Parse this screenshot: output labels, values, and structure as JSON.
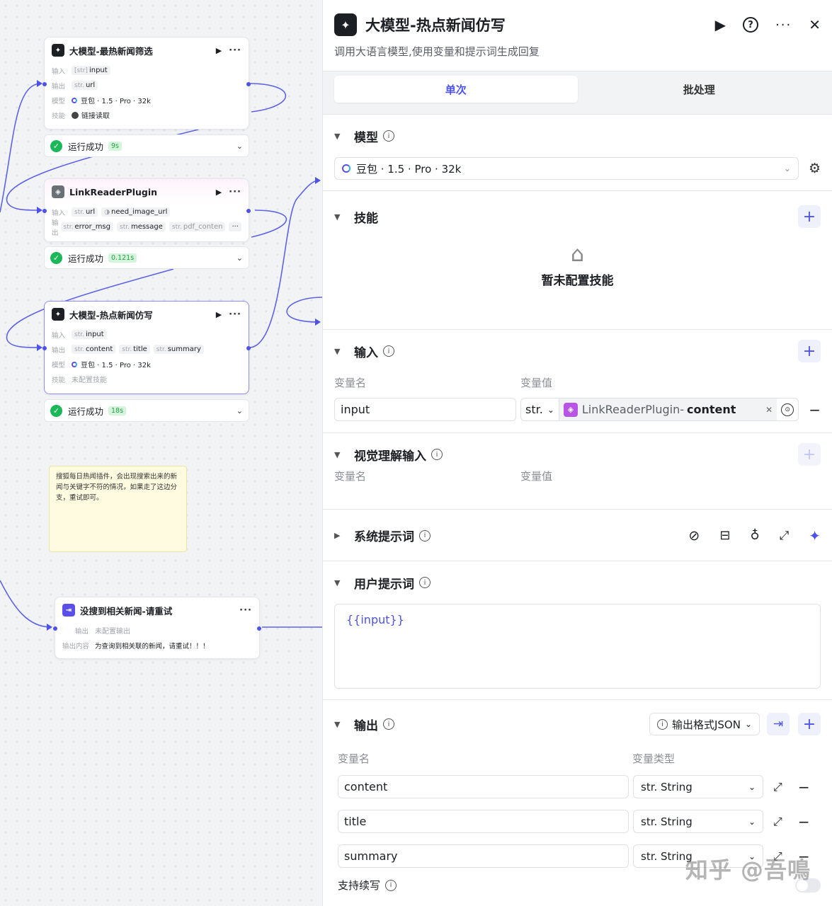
{
  "nodes": {
    "n1": {
      "title": "大模型-最热新闻筛选",
      "in_label": "输入",
      "in_type": "[str]",
      "in_val": "input",
      "out_label": "输出",
      "out_type": "str.",
      "out_val": "url",
      "model_label": "模型",
      "model": "豆包 · 1.5 · Pro · 32k",
      "skill_label": "技能",
      "skill": "链接读取"
    },
    "n2": {
      "title": "LinkReaderPlugin",
      "in_label": "输入",
      "in_type1": "str.",
      "in_val1": "url",
      "in_val2": "need_image_url",
      "out_label": "输出",
      "out_type": "str.",
      "out_val1": "error_msg",
      "out_val2": "message",
      "out_val3": "pdf_conten",
      "more": "···"
    },
    "n3": {
      "title": "大模型-热点新闻仿写",
      "in_label": "输入",
      "in_type": "str.",
      "in_val": "input",
      "out_label": "输出",
      "out_type": "str.",
      "out_val1": "content",
      "out_val2": "title",
      "out_val3": "summary",
      "model_label": "模型",
      "model": "豆包 · 1.5 · Pro · 32k",
      "skill_label": "技能",
      "skill": "未配置技能"
    },
    "n4": {
      "title": "没搜到相关新闻-请重试",
      "out_label": "输出",
      "out_val": "未配置输出",
      "content_label": "输出内容",
      "content": "为查询到相关联的新闻，请重试！！！"
    }
  },
  "statuses": [
    {
      "text": "运行成功",
      "time": "9s"
    },
    {
      "text": "运行成功",
      "time": "0.121s"
    },
    {
      "text": "运行成功",
      "time": "18s"
    }
  ],
  "note": "搜狐每日热闻插件，会出现搜索出来的新闻与关键字不符的情况，如果走了这边分支，重试即可。",
  "panel": {
    "title": "大模型-热点新闻仿写",
    "desc": "调用大语言模型,使用变量和提示词生成回复",
    "tabs": [
      "单次",
      "批处理"
    ],
    "model_section": "模型",
    "model_value": "豆包 · 1.5 · Pro · 32k",
    "skills_section": "技能",
    "skills_empty": "暂未配置技能",
    "input_section": "输入",
    "col_name": "变量名",
    "col_value": "变量值",
    "input_name": "input",
    "input_type": "str.",
    "input_ref_node": "LinkReaderPlugin",
    "input_ref_sep": " - ",
    "input_ref_field": "content",
    "visual_section": "视觉理解输入",
    "system_section": "系统提示词",
    "user_section": "用户提示词",
    "user_prompt": "{{input}}",
    "output_section": "输出",
    "output_format": "输出格式JSON",
    "col_type": "变量类型",
    "outputs": [
      {
        "name": "content",
        "type": "str. String"
      },
      {
        "name": "title",
        "type": "str. String"
      },
      {
        "name": "summary",
        "type": "str. String"
      }
    ],
    "continue_label": "支持续写"
  },
  "watermark": "知乎 @吾鳴"
}
